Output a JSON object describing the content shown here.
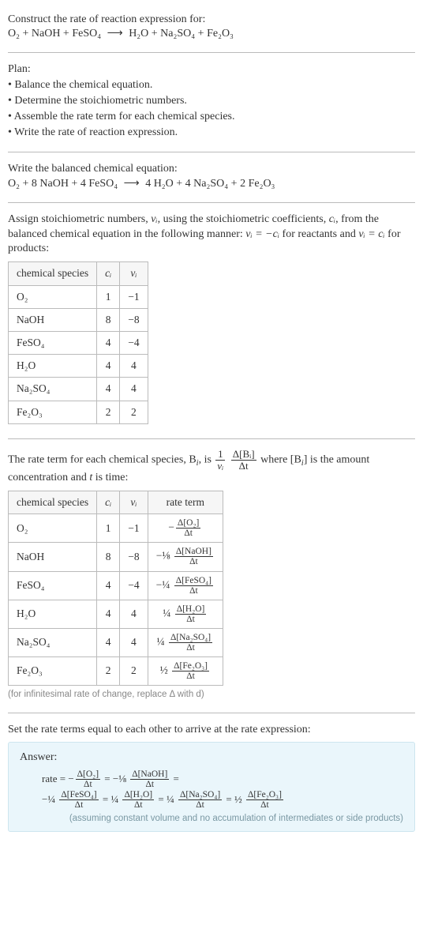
{
  "prompt": {
    "title": "Construct the rate of reaction expression for:",
    "equation_lhs": "O₂ + NaOH + FeSO₄",
    "arrow": "⟶",
    "equation_rhs": "H₂O + Na₂SO₄ + Fe₂O₃"
  },
  "plan": {
    "heading": "Plan:",
    "items": [
      "• Balance the chemical equation.",
      "• Determine the stoichiometric numbers.",
      "• Assemble the rate term for each chemical species.",
      "• Write the rate of reaction expression."
    ]
  },
  "balanced": {
    "heading": "Write the balanced chemical equation:",
    "equation_lhs": "O₂ + 8 NaOH + 4 FeSO₄",
    "arrow": "⟶",
    "equation_rhs": "4 H₂O + 4 Na₂SO₄ + 2 Fe₂O₃"
  },
  "stoich": {
    "intro_a": "Assign stoichiometric numbers, ",
    "nu_i": "νᵢ",
    "intro_b": ", using the stoichiometric coefficients, ",
    "c_i": "cᵢ",
    "intro_c": ", from the balanced chemical equation in the following manner: ",
    "rel1": "νᵢ = −cᵢ",
    "intro_d": " for reactants and ",
    "rel2": "νᵢ = cᵢ",
    "intro_e": " for products:",
    "headers": [
      "chemical species",
      "cᵢ",
      "νᵢ"
    ],
    "rows": [
      {
        "sp": "O₂",
        "c": "1",
        "v": "−1"
      },
      {
        "sp": "NaOH",
        "c": "8",
        "v": "−8"
      },
      {
        "sp": "FeSO₄",
        "c": "4",
        "v": "−4"
      },
      {
        "sp": "H₂O",
        "c": "4",
        "v": "4"
      },
      {
        "sp": "Na₂SO₄",
        "c": "4",
        "v": "4"
      },
      {
        "sp": "Fe₂O₃",
        "c": "2",
        "v": "2"
      }
    ]
  },
  "rateterm": {
    "intro_a": "The rate term for each chemical species, B",
    "sub_i": "i",
    "intro_b": ", is ",
    "frac1_num": "1",
    "frac1_den": "νᵢ",
    "frac2_num": "Δ[Bᵢ]",
    "frac2_den": "Δt",
    "intro_c": " where [B",
    "intro_d": "] is the amount concentration and ",
    "t_it": "t",
    "intro_e": " is time:",
    "headers": [
      "chemical species",
      "cᵢ",
      "νᵢ",
      "rate term"
    ],
    "rows": [
      {
        "sp": "O₂",
        "c": "1",
        "v": "−1",
        "pre": "−",
        "num": "Δ[O₂]",
        "den": "Δt"
      },
      {
        "sp": "NaOH",
        "c": "8",
        "v": "−8",
        "pre": "−⅛ ",
        "num": "Δ[NaOH]",
        "den": "Δt"
      },
      {
        "sp": "FeSO₄",
        "c": "4",
        "v": "−4",
        "pre": "−¼ ",
        "num": "Δ[FeSO₄]",
        "den": "Δt"
      },
      {
        "sp": "H₂O",
        "c": "4",
        "v": "4",
        "pre": "¼ ",
        "num": "Δ[H₂O]",
        "den": "Δt"
      },
      {
        "sp": "Na₂SO₄",
        "c": "4",
        "v": "4",
        "pre": "¼ ",
        "num": "Δ[Na₂SO₄]",
        "den": "Δt"
      },
      {
        "sp": "Fe₂O₃",
        "c": "2",
        "v": "2",
        "pre": "½ ",
        "num": "Δ[Fe₂O₃]",
        "den": "Δt"
      }
    ],
    "footnote": "(for infinitesimal rate of change, replace Δ with d)"
  },
  "final": {
    "heading": "Set the rate terms equal to each other to arrive at the rate expression:"
  },
  "answer": {
    "title": "Answer:",
    "line1": {
      "lead": "rate = −",
      "t1_num": "Δ[O₂]",
      "t1_den": "Δt",
      "eq1": " = −⅛ ",
      "t2_num": "Δ[NaOH]",
      "t2_den": "Δt",
      "eq2": " ="
    },
    "line2": {
      "lead": "−¼ ",
      "t3_num": "Δ[FeSO₄]",
      "t3_den": "Δt",
      "eq3": " = ¼ ",
      "t4_num": "Δ[H₂O]",
      "t4_den": "Δt",
      "eq4": " = ¼ ",
      "t5_num": "Δ[Na₂SO₄]",
      "t5_den": "Δt",
      "eq5": " = ½ ",
      "t6_num": "Δ[Fe₂O₃]",
      "t6_den": "Δt"
    },
    "note": "(assuming constant volume and no accumulation of intermediates or side products)"
  }
}
